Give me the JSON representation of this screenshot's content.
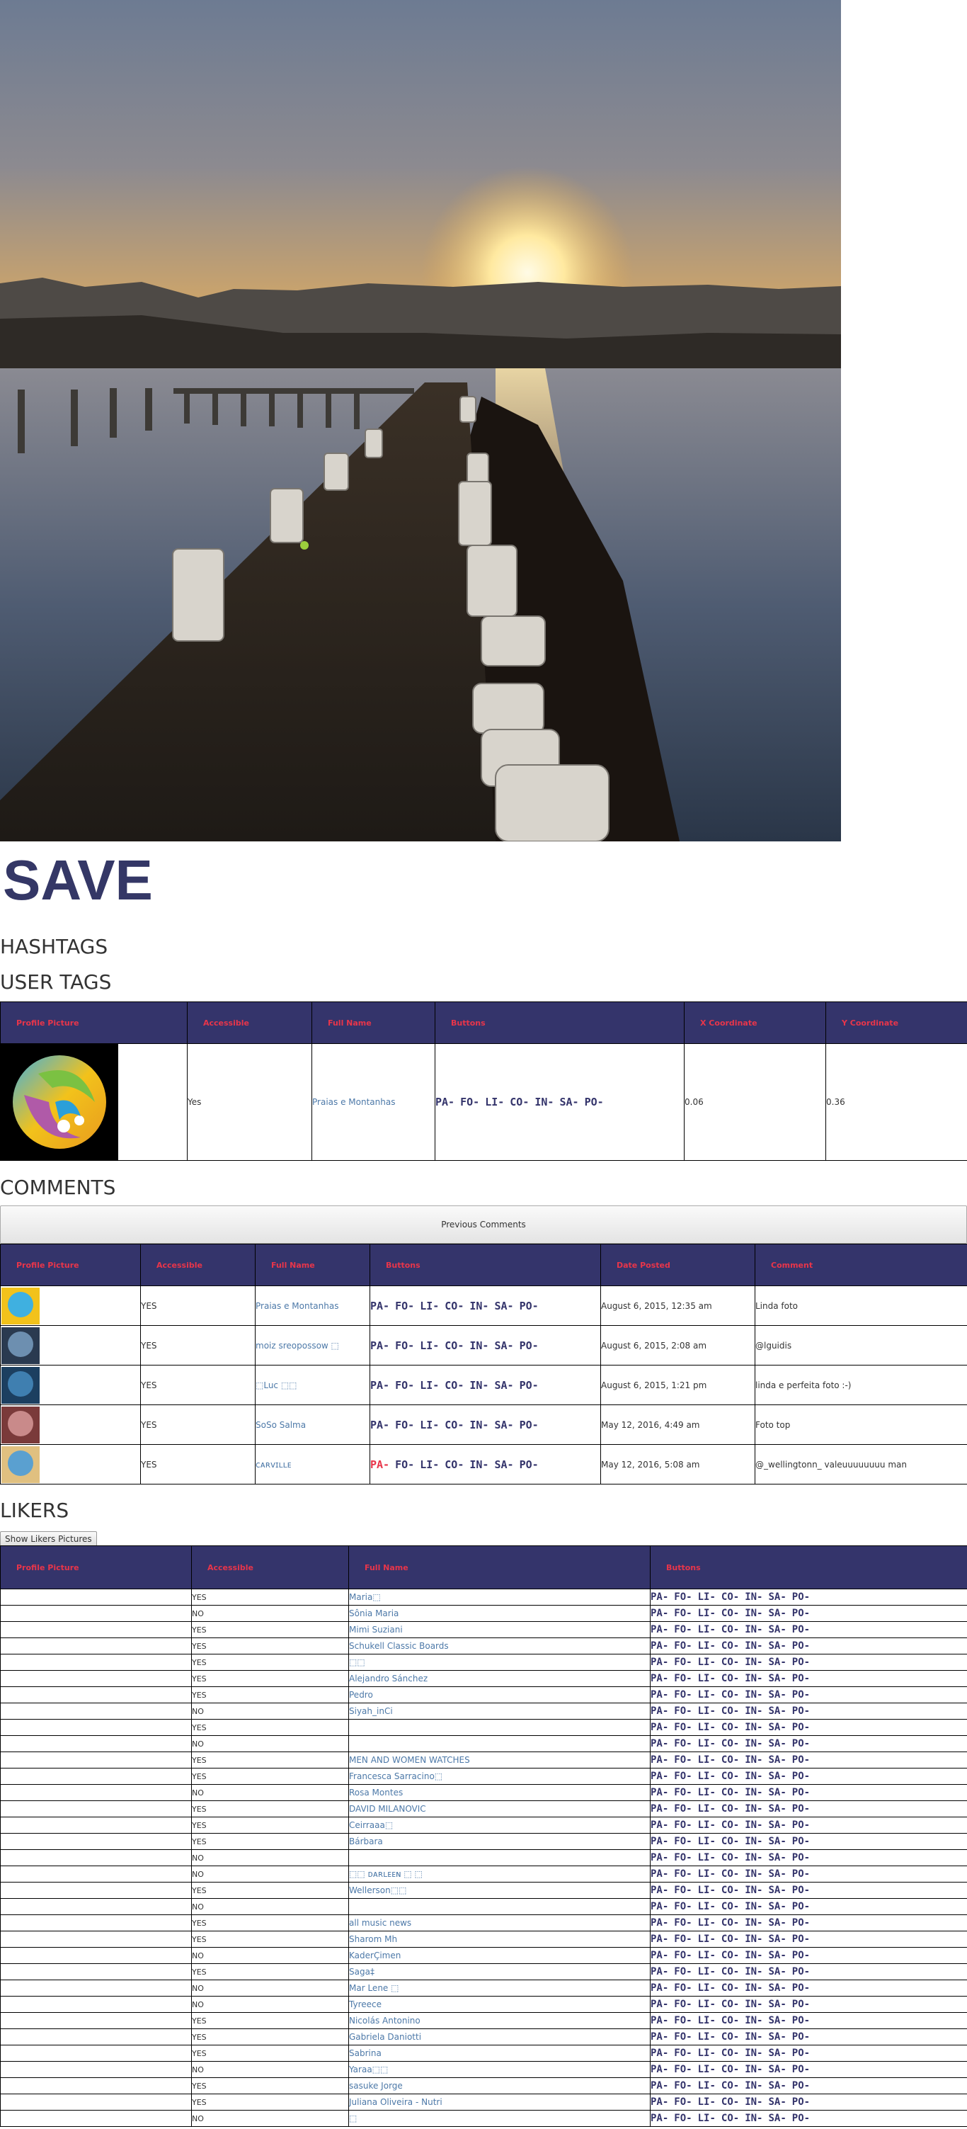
{
  "hero": {
    "image_desc_icon": "sunset-pier-photo"
  },
  "title": "SAVE",
  "sections": {
    "hashtags": "HASHTAGS",
    "user_tags": "USER TAGS",
    "comments": "COMMENTS",
    "likers": "LIKERS"
  },
  "button_letters": [
    "PA-",
    "FO-",
    "LI-",
    "CO-",
    "IN-",
    "SA-",
    "PO-"
  ],
  "user_tags": {
    "columns": [
      "Profile Picture",
      "Accessible",
      "Full Name",
      "Buttons",
      "X Coordinate",
      "Y Coordinate"
    ],
    "rows": [
      {
        "accessible": "Yes",
        "full_name": "Praias e Montanhas",
        "x": "0.06",
        "y": "0.36"
      }
    ]
  },
  "comments": {
    "previous_label": "Previous Comments",
    "columns": [
      "Profile Picture",
      "Accessible",
      "Full Name",
      "Buttons",
      "Date Posted",
      "Comment"
    ],
    "rows": [
      {
        "accessible": "YES",
        "full_name": "Praias e Montanhas",
        "date": "August 6, 2015, 12:35 am",
        "comment": "Linda foto"
      },
      {
        "accessible": "YES",
        "full_name": "moiz sreopossow ⬚",
        "date": "August 6, 2015, 2:08 am",
        "comment": "@lguidis"
      },
      {
        "accessible": "YES",
        "full_name": "⬚Luc ⬚⬚",
        "date": "August 6, 2015, 1:21 pm",
        "comment": "linda e perfeita foto :-)"
      },
      {
        "accessible": "YES",
        "full_name": "SoSo Salma",
        "date": "May 12, 2016, 4:49 am",
        "comment": "Foto top"
      },
      {
        "accessible": "YES",
        "full_name": "ᴄᴀʀᴠɪʟʟᴇ",
        "date": "May 12, 2016, 5:08 am",
        "comment": "@_wellingtonn_ valeuuuuuuuu man"
      }
    ]
  },
  "likers": {
    "show_pictures_label": "Show Likers Pictures",
    "columns": [
      "Profile Picture",
      "Accessible",
      "Full Name",
      "Buttons"
    ],
    "rows": [
      {
        "accessible": "YES",
        "full_name": "Maria⬚"
      },
      {
        "accessible": "NO",
        "full_name": "Sônia Maria"
      },
      {
        "accessible": "YES",
        "full_name": "Mimi Suziani"
      },
      {
        "accessible": "YES",
        "full_name": "Schukell Classic Boards"
      },
      {
        "accessible": "YES",
        "full_name": "⬚⬚"
      },
      {
        "accessible": "YES",
        "full_name": "Alejandro Sánchez"
      },
      {
        "accessible": "YES",
        "full_name": "Pedro"
      },
      {
        "accessible": "NO",
        "full_name": "Siyah_inCi"
      },
      {
        "accessible": "YES",
        "full_name": ""
      },
      {
        "accessible": "NO",
        "full_name": ""
      },
      {
        "accessible": "YES",
        "full_name": "MEN AND WOMEN WATCHES"
      },
      {
        "accessible": "YES",
        "full_name": "Francesca Sarracino⬚"
      },
      {
        "accessible": "NO",
        "full_name": "Rosa Montes"
      },
      {
        "accessible": "YES",
        "full_name": "DAVID MILANOVIC"
      },
      {
        "accessible": "YES",
        "full_name": "Ceirraaa⬚"
      },
      {
        "accessible": "YES",
        "full_name": "Bárbara"
      },
      {
        "accessible": "NO",
        "full_name": ""
      },
      {
        "accessible": "NO",
        "full_name": "⬚⬚ ᴅᴀʀʟᴇᴇɴ ⬚ ⬚"
      },
      {
        "accessible": "YES",
        "full_name": "Wellerson⬚⬚"
      },
      {
        "accessible": "NO",
        "full_name": ""
      },
      {
        "accessible": "YES",
        "full_name": "all music news"
      },
      {
        "accessible": "YES",
        "full_name": "Sharom Mh"
      },
      {
        "accessible": "NO",
        "full_name": "KaderÇimen"
      },
      {
        "accessible": "YES",
        "full_name": "Saga‡"
      },
      {
        "accessible": "NO",
        "full_name": "Mar Lene ⬚"
      },
      {
        "accessible": "NO",
        "full_name": "Tyreece"
      },
      {
        "accessible": "YES",
        "full_name": "Nicolás Antonino"
      },
      {
        "accessible": "YES",
        "full_name": "Gabriela Daniotti"
      },
      {
        "accessible": "YES",
        "full_name": "Sabrina"
      },
      {
        "accessible": "NO",
        "full_name": "Yaraa⬚⬚"
      },
      {
        "accessible": "YES",
        "full_name": "sasuke Jorge"
      },
      {
        "accessible": "YES",
        "full_name": "Juliana Oliveira - Nutri"
      },
      {
        "accessible": "NO",
        "full_name": "⬚"
      }
    ]
  },
  "colors": {
    "header_bg": "#34346b",
    "header_text": "#e8354a",
    "link": "#4d79a8",
    "title": "#343766"
  }
}
